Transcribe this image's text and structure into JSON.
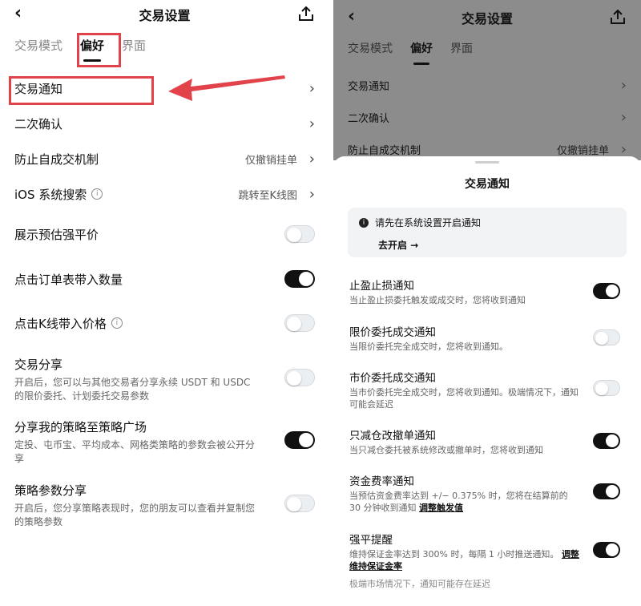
{
  "left": {
    "title": "交易设置",
    "tabs": [
      "交易模式",
      "偏好",
      "界面"
    ],
    "active_tab": "偏好",
    "rows": [
      {
        "label": "交易通知",
        "value": "",
        "chevron": true
      },
      {
        "label": "二次确认",
        "value": "",
        "chevron": true
      },
      {
        "label": "防止自成交机制",
        "value": "仅撤销挂单",
        "chevron": true
      },
      {
        "label": "iOS 系统搜索",
        "value": "跳转至K线图",
        "chevron": true,
        "info": true
      },
      {
        "label": "展示预估强平价",
        "toggle": false
      },
      {
        "label": "点击订单表带入数量",
        "toggle": true
      },
      {
        "label": "点击K线带入价格",
        "toggle": false,
        "info": true
      }
    ],
    "multi": [
      {
        "title": "交易分享",
        "desc": "开启后，您可以与其他交易者分享永续 USDT 和 USDC 的限价委托、计划委托交易参数",
        "toggle": false
      },
      {
        "title": "分享我的策略至策略广场",
        "desc": "定投、屯币宝、平均成本、网格类策略的参数会被公开分享",
        "toggle": true
      },
      {
        "title": "策略参数分享",
        "desc": "开启后，您分享策略表现时，您的朋友可以查看并复制您的策略参数",
        "toggle": false
      }
    ]
  },
  "right": {
    "title": "交易设置",
    "tabs": [
      "交易模式",
      "偏好",
      "界面"
    ],
    "rows": [
      {
        "label": "交易通知",
        "value": ""
      },
      {
        "label": "二次确认",
        "value": ""
      },
      {
        "label": "防止自成交机制",
        "value": "仅撤销挂单"
      }
    ],
    "sheet": {
      "title": "交易通知",
      "notice": "请先在系统设置开启通知",
      "notice_action": "去开启 →",
      "items": [
        {
          "title": "止盈止损通知",
          "desc": "当止盈止损委托触发或成交时，您将收到通知",
          "toggle": true
        },
        {
          "title": "限价委托成交通知",
          "desc": "当限价委托完全成交时，您将收到通知。",
          "toggle": false
        },
        {
          "title": "市价委托成交通知",
          "desc": "当市价委托完全成交时，您将收到通知。极端情况下，通知可能会延迟",
          "toggle": false
        },
        {
          "title": "只减仓改撤单通知",
          "desc": "当只减仓委托被系统修改或撤单时，您将收到通知",
          "toggle": true
        },
        {
          "title": "资金费率通知",
          "desc": "当预估资金费率达到 +/− 0.375% 时，您将在结算前的 30 分钟收到通知",
          "link": "调整触发值",
          "toggle": true
        },
        {
          "title": "强平提醒",
          "desc": "维持保证金率达到 300% 时，每隔 1 小时推送通知。",
          "link": "调整维持保证金率",
          "toggle": true
        }
      ],
      "footnote": "极端市场情况下，通知可能存在延迟"
    }
  },
  "icons": {
    "back": "chevron-left-icon",
    "share": "share-icon",
    "info": "info-icon",
    "arrow": "red-annotation-arrow"
  },
  "colors": {
    "annotation": "#e2434b",
    "toggle_on": "#111111",
    "toggle_off": "#eceff2",
    "overlay": "#8c8c8c"
  }
}
